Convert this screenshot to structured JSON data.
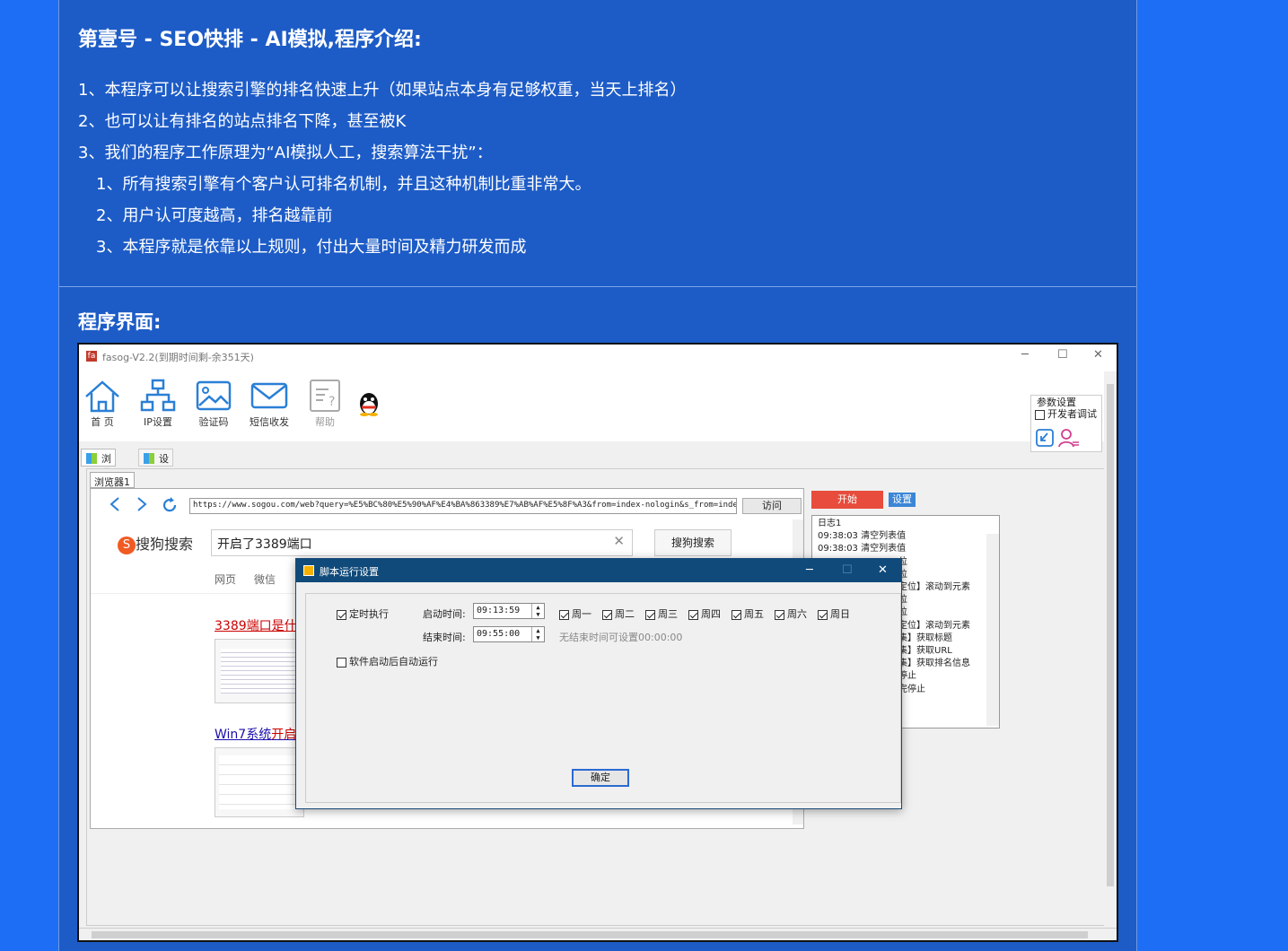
{
  "heading": "第壹号 - SEO快排 - AI模拟,程序介绍:",
  "lines": [
    "1、本程序可以让搜索引擎的排名快速上升（如果站点本身有足够权重，当天上排名）",
    "2、也可以让有排名的站点排名下降，甚至被K",
    "3、我们的程序工作原理为“AI模拟人工，搜索算法干扰”：",
    "1、所有搜索引擎有个客户认可排名机制，并且这种机制比重非常大。",
    "2、用户认可度越高，排名越靠前",
    "3、本程序就是依靠以上规则，付出大量时间及精力研发而成"
  ],
  "section_title": "程序界面:",
  "app": {
    "title": "fasog-V2.2(到期时间剩-余351天)",
    "logo": "fa",
    "toolbar": [
      "首 页",
      "IP设置",
      "验证码",
      "短信收发",
      "帮助"
    ],
    "params_title": "参数设置",
    "dev_debug": "开发者调试",
    "tabs": [
      "浏览器",
      "设置内容"
    ],
    "browser_tab": "浏览器1",
    "url": "https://www.sogou.com/web?query=%E5%BC%80%E5%90%AF%E4%BA%863389%E7%AB%AF%E5%8F%A3&from=index-nologin&s_from=index",
    "visit": "访问",
    "sogou_label": "搜狗搜索",
    "search_value": "开启了3389端口",
    "search_btn": "搜狗搜索",
    "search_tabs": [
      "网页",
      "微信"
    ],
    "result1": "3389端口是什",
    "result2_a": "Win7系统",
    "result2_b": "开启",
    "start": "开始",
    "settings": "设置",
    "log_title": "日志1",
    "log": [
      "09:38:03  清空列表值",
      "09:38:03  清空列表值",
      "位",
      "位",
      "定位】滚动到元素",
      "位",
      "位",
      "定位】滚动到元素",
      "集】获取标题",
      "集】获取URL",
      "集】获取排名信息",
      "停止",
      "完停止"
    ]
  },
  "dialog": {
    "title": "脚本运行设置",
    "timed_exec": "定时执行",
    "start_label": "启动时间:",
    "start_time": "09:13:59",
    "end_label": "结束时间:",
    "end_time": "09:55:00",
    "end_hint": "无结束时间可设置00:00:00",
    "days": [
      "周一",
      "周二",
      "周三",
      "周四",
      "周五",
      "周六",
      "周日"
    ],
    "autorun": "软件启动后自动运行",
    "ok": "确定"
  },
  "colors": {
    "page_bg": "#1e6ef5",
    "panel_bg": "#1d5cc7",
    "start_btn": "#e74c3c",
    "dialog_title": "#0f4a7a"
  }
}
